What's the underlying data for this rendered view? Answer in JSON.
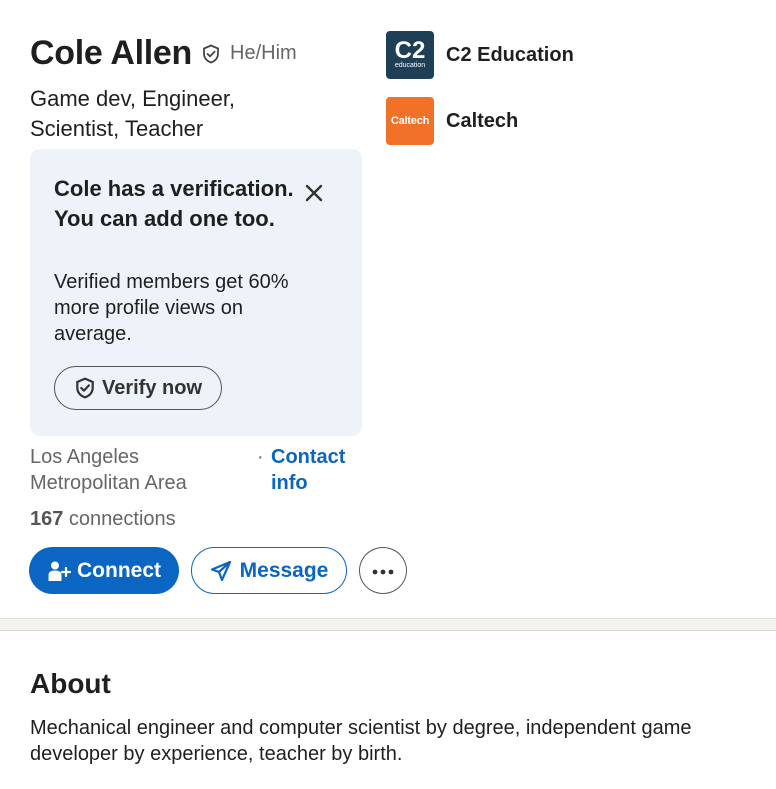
{
  "profile": {
    "name": "Cole Allen",
    "pronouns": "He/Him",
    "headline": "Game dev, Engineer, Scientist,  Teacher",
    "location": "Los Angeles Metropolitan Area",
    "dot": "·",
    "contact_label": "Contact info",
    "connections_count": "167",
    "connections_label": " connections"
  },
  "verification_card": {
    "title": "Cole has a verification. You can add one too.",
    "description": "Verified members get 60% more profile views on average.",
    "button_label": "Verify now"
  },
  "actions": {
    "connect_label": "Connect",
    "message_label": "Message",
    "more_icon": "ellipsis-icon"
  },
  "organizations": [
    {
      "name": "C2 Education",
      "logo_big": "C2",
      "logo_small": "education",
      "logo_color": "#1f3f57"
    },
    {
      "name": "Caltech",
      "logo_text": "Caltech",
      "logo_color": "#f27128"
    }
  ],
  "about": {
    "title": "About",
    "text": "Mechanical engineer and computer scientist by degree, independent game developer by experience, teacher by birth."
  },
  "colors": {
    "primary": "#0a66c2",
    "verify_card_bg": "#edf3f8",
    "muted_text": "#666666"
  }
}
